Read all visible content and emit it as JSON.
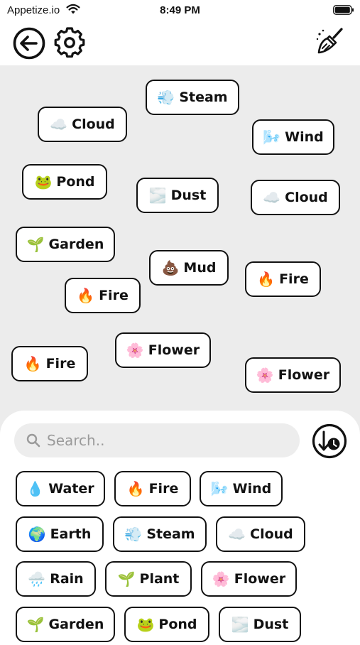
{
  "status": {
    "carrier": "Appetize.io",
    "time": "8:49 PM",
    "wifi_icon": "wifi-icon",
    "battery_icon": "battery-icon"
  },
  "toolbar": {
    "back_icon": "arrow-left-circle-icon",
    "settings_icon": "gear-icon",
    "clear_icon": "broom-icon"
  },
  "canvas_items": [
    {
      "emoji": "💨",
      "label": "Steam"
    },
    {
      "emoji": "☁️",
      "label": "Cloud"
    },
    {
      "emoji": "🌬️",
      "label": "Wind"
    },
    {
      "emoji": "🐸",
      "label": "Pond"
    },
    {
      "emoji": "🌫️",
      "label": "Dust"
    },
    {
      "emoji": "☁️",
      "label": "Cloud"
    },
    {
      "emoji": "🌱",
      "label": "Garden"
    },
    {
      "emoji": "💩",
      "label": "Mud"
    },
    {
      "emoji": "🔥",
      "label": "Fire"
    },
    {
      "emoji": "🔥",
      "label": "Fire"
    },
    {
      "emoji": "🌸",
      "label": "Flower"
    },
    {
      "emoji": "🔥",
      "label": "Fire"
    },
    {
      "emoji": "🌸",
      "label": "Flower"
    }
  ],
  "search": {
    "placeholder": "Search..",
    "value": ""
  },
  "sort_icon": "sort-by-time-icon",
  "inventory": [
    {
      "emoji": "💧",
      "label": "Water"
    },
    {
      "emoji": "🔥",
      "label": "Fire"
    },
    {
      "emoji": "🌬️",
      "label": "Wind"
    },
    {
      "emoji": "🌍",
      "label": "Earth"
    },
    {
      "emoji": "💨",
      "label": "Steam"
    },
    {
      "emoji": "☁️",
      "label": "Cloud"
    },
    {
      "emoji": "🌧️",
      "label": "Rain"
    },
    {
      "emoji": "🌱",
      "label": "Plant"
    },
    {
      "emoji": "🌸",
      "label": "Flower"
    },
    {
      "emoji": "🌱",
      "label": "Garden"
    },
    {
      "emoji": "🐸",
      "label": "Pond"
    },
    {
      "emoji": "🌫️",
      "label": "Dust"
    }
  ]
}
